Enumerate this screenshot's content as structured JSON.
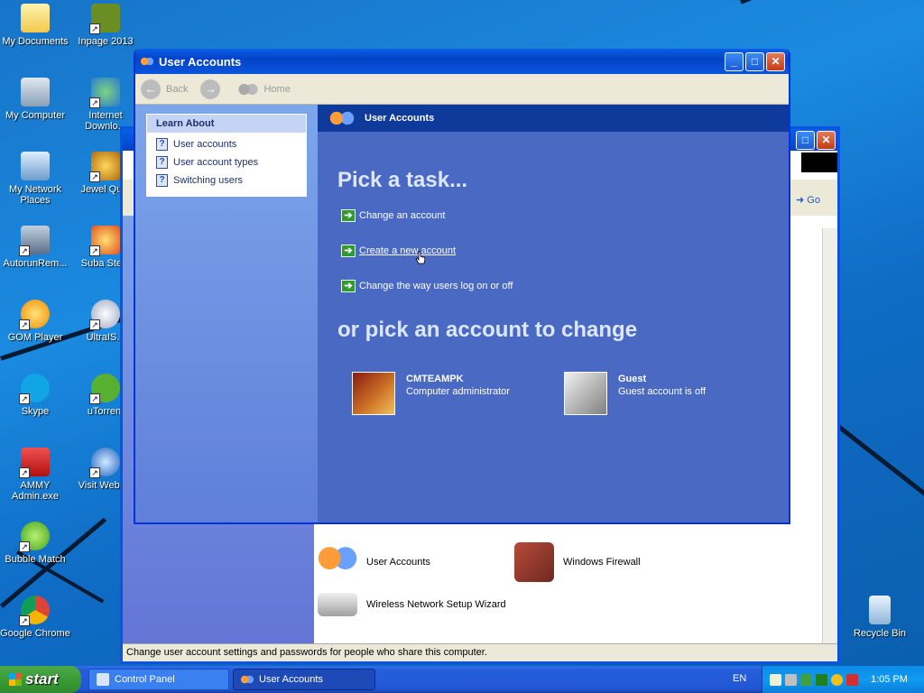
{
  "desktop": {
    "icons": [
      {
        "label": "My Documents",
        "icon": "folder-icon"
      },
      {
        "label": "Inpage 2013",
        "icon": "app-icon"
      },
      {
        "label": "My Computer",
        "icon": "computer-icon"
      },
      {
        "label": "Internet Downlo...",
        "icon": "download-icon"
      },
      {
        "label": "My Network Places",
        "icon": "network-icon"
      },
      {
        "label": "Jewel Qu...",
        "icon": "game-icon"
      },
      {
        "label": "AutorunRem...",
        "icon": "app-icon"
      },
      {
        "label": "Suba Ste...",
        "icon": "game-icon"
      },
      {
        "label": "GOM Player",
        "icon": "media-icon"
      },
      {
        "label": "UltraIS...",
        "icon": "disc-icon"
      },
      {
        "label": "Skype",
        "icon": "skype-icon"
      },
      {
        "label": "uTorrent",
        "icon": "torrent-icon"
      },
      {
        "label": "AMMY Admin.exe",
        "icon": "remote-icon"
      },
      {
        "label": "Visit Webs...",
        "icon": "web-icon"
      },
      {
        "label": "Bubble Match",
        "icon": "game-icon"
      },
      {
        "label": "Google Chrome",
        "icon": "chrome-icon"
      },
      {
        "label": "Recycle Bin",
        "icon": "recycle-bin-icon"
      }
    ]
  },
  "control_panel": {
    "go_label": "Go",
    "items": [
      {
        "label": "User Accounts",
        "icon": "user-accounts-icon"
      },
      {
        "label": "Windows Firewall",
        "icon": "firewall-icon"
      },
      {
        "label": "Wireless Network Setup Wizard",
        "icon": "wireless-icon"
      }
    ],
    "status_text": "Change user account settings and passwords for people who share this computer."
  },
  "ua_window": {
    "title": "User Accounts",
    "toolbar": {
      "back_label": "Back",
      "home_label": "Home"
    },
    "learn_about": {
      "heading": "Learn About",
      "links": [
        "User accounts",
        "User account types",
        "Switching users"
      ]
    },
    "header_title": "User Accounts",
    "pick_task_heading": "Pick a task...",
    "tasks": [
      "Change an account",
      "Create a new account",
      "Change the way users log on or off"
    ],
    "pick_account_heading": "or pick an account to change",
    "accounts": [
      {
        "name": "CMTEAMPK",
        "description": "Computer administrator",
        "picture": "chess-picture"
      },
      {
        "name": "Guest",
        "description": "Guest account is off",
        "picture": "briefcase-picture"
      }
    ]
  },
  "taskbar": {
    "start_label": "start",
    "tasks": [
      {
        "label": "Control Panel",
        "active": false
      },
      {
        "label": "User Accounts",
        "active": true
      }
    ],
    "language": "EN",
    "clock": "1:05 PM"
  },
  "colors": {
    "ua_main_bg": "#4a69c2",
    "ua_header_bg": "#0e3a9c",
    "titlebar_blue": "#0a55dd",
    "start_green": "#3c9a37"
  }
}
